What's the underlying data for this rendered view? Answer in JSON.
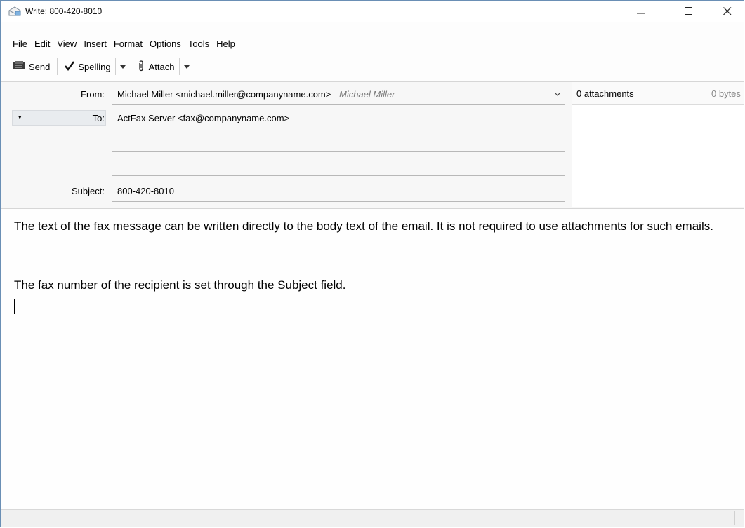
{
  "window": {
    "title": "Write: 800-420-8010"
  },
  "menu": [
    "File",
    "Edit",
    "View",
    "Insert",
    "Format",
    "Options",
    "Tools",
    "Help"
  ],
  "toolbar": {
    "send": "Send",
    "spelling": "Spelling",
    "attach": "Attach"
  },
  "header": {
    "from_label": "From:",
    "from_value": "Michael Miller <michael.miller@companyname.com>",
    "from_identity": "Michael Miller",
    "to_label": "To:",
    "to_value": "ActFax Server <fax@companyname.com>",
    "subject_label": "Subject:",
    "subject_value": "800-420-8010"
  },
  "attachments": {
    "count_label": "0 attachments",
    "size_label": "0 bytes"
  },
  "body": {
    "para1": "The text of the fax message can be written directly to the body text of the email. It is not required to use attachments for such emails.",
    "para2": "The fax number of the recipient is set through the Subject field."
  },
  "icons": {
    "app": "envelope-write-icon",
    "send": "send-icon",
    "spelling": "checkmark-icon",
    "attach": "paperclip-icon"
  },
  "colors": {
    "header_bg": "#f7f7f7",
    "window_border": "#6a8fb5"
  }
}
